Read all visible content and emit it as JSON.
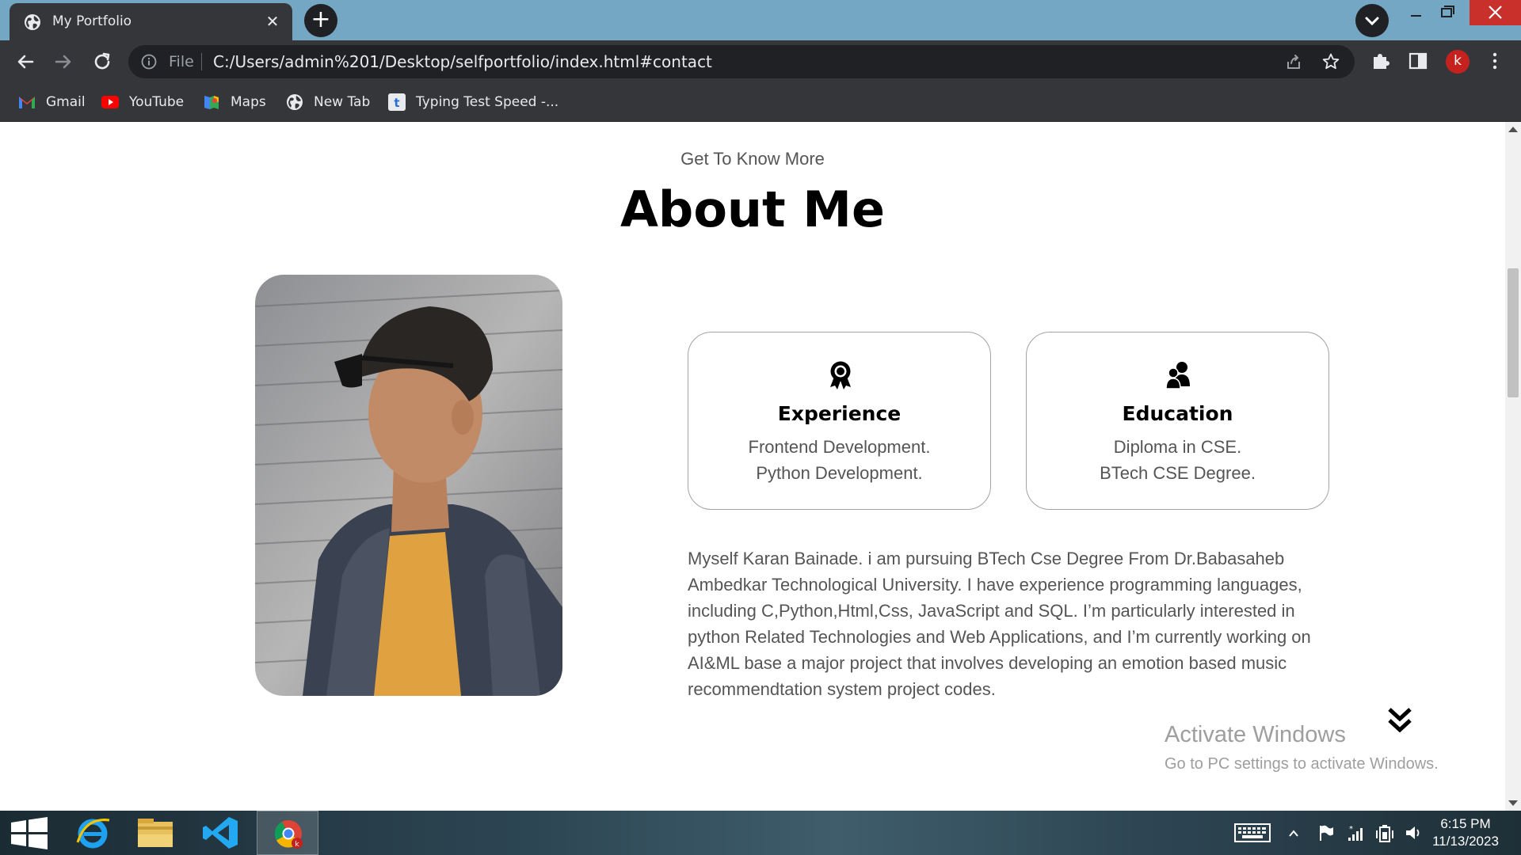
{
  "browser": {
    "tab_title": "My Portfolio",
    "url_scheme_label": "File",
    "url": "C:/Users/admin%201/Desktop/selfportfolio/index.html#contact",
    "profile_initial": "k",
    "bookmarks": [
      {
        "label": "Gmail",
        "icon": "gmail-icon"
      },
      {
        "label": "YouTube",
        "icon": "youtube-icon"
      },
      {
        "label": "Maps",
        "icon": "maps-icon"
      },
      {
        "label": "New Tab",
        "icon": "globe-icon"
      },
      {
        "label": "Typing Test Speed -...",
        "icon": "typing-test-icon"
      }
    ]
  },
  "page": {
    "subtitle": "Get To Know More",
    "title": "About Me",
    "cards": [
      {
        "title": "Experience",
        "line1": "Frontend Development.",
        "line2": "Python Development.",
        "icon": "award-icon"
      },
      {
        "title": "Education",
        "line1": "Diploma in CSE.",
        "line2": "BTech CSE Degree.",
        "icon": "users-icon"
      }
    ],
    "bio": "Myself Karan Bainade. i am pursuing BTech Cse Degree From Dr.Babasaheb Ambedkar Technological University. I have experience programming languages, including C,Python,Html,Css, JavaScript and SQL. I’m particularly interested in python Related Technologies and Web Applications, and I’m currently working on AI&ML base a major project that involves developing an emotion based music recommendtation system project codes."
  },
  "watermark": {
    "line1": "Activate Windows",
    "line2": "Go to PC settings to activate Windows."
  },
  "taskbar": {
    "time": "6:15 PM",
    "date": "11/13/2023"
  }
}
